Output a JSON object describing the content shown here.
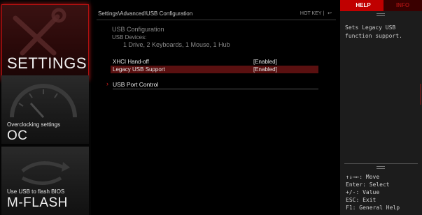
{
  "sidebar": {
    "settings": {
      "label": "SETTINGS"
    },
    "oc": {
      "subtitle": "Overclocking settings",
      "label": "OC"
    },
    "mflash": {
      "subtitle": "Use USB to flash BIOS",
      "label": "M-FLASH"
    }
  },
  "header": {
    "breadcrumb": "Settings\\Advanced\\USB Configuration",
    "hotkey": "HOT KEY  |",
    "back_icon": "back-arrow-icon"
  },
  "content": {
    "section_title": "USB Configuration",
    "devices_label": "USB Devices:",
    "devices_value": "1 Drive, 2 Keyboards, 1 Mouse, 1 Hub",
    "options": [
      {
        "label": "XHCI Hand-off",
        "value": "[Enabled]",
        "selected": false
      },
      {
        "label": "Legacy USB Support",
        "value": "[Enabled]",
        "selected": true
      }
    ],
    "submenu": {
      "label": "USB Port Control"
    }
  },
  "help": {
    "tab_help": "HELP",
    "tab_info": "INFO",
    "text": "Sets Legacy USB function support.",
    "keys": [
      "↑↓→←: Move",
      "Enter: Select",
      "+/-: Value",
      "ESC: Exit",
      "F1: General Help"
    ]
  },
  "colors": {
    "accent": "#c00000",
    "selected_row": "#5a1010",
    "background": "#000000"
  }
}
